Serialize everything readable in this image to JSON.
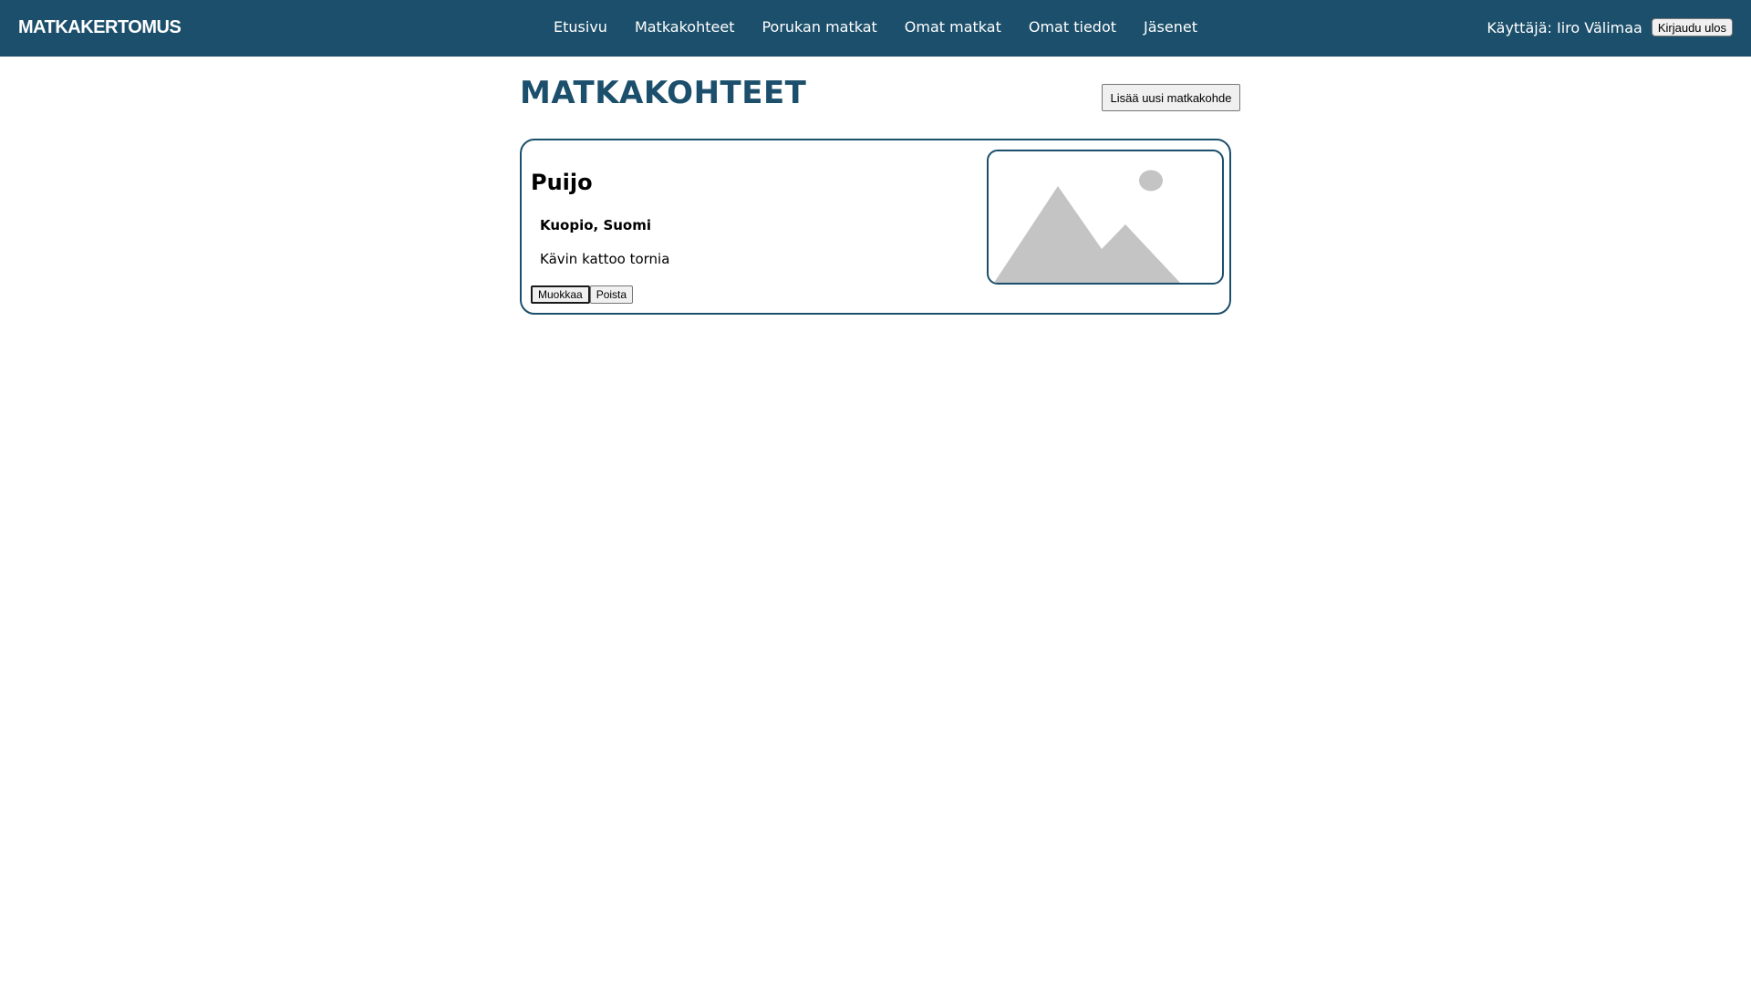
{
  "header": {
    "brand": "MATKAKERTOMUS",
    "nav": [
      "Etusivu",
      "Matkakohteet",
      "Porukan matkat",
      "Omat matkat",
      "Omat tiedot",
      "Jäsenet"
    ],
    "user_label": "Käyttäjä: Iiro Välimaa",
    "logout_label": "Kirjaudu ulos"
  },
  "main": {
    "title": "MATKAKOHTEET",
    "add_label": "Lisää uusi matkakohde",
    "destinations": [
      {
        "name": "Puijo",
        "location": "Kuopio, Suomi",
        "description": "Kävin kattoo tornia",
        "edit_label": "Muokkaa",
        "delete_label": "Poista",
        "image_icon": "image-placeholder-icon"
      }
    ]
  },
  "colors": {
    "primary": "#1b4f6b",
    "placeholder": "#c4c4c4"
  }
}
